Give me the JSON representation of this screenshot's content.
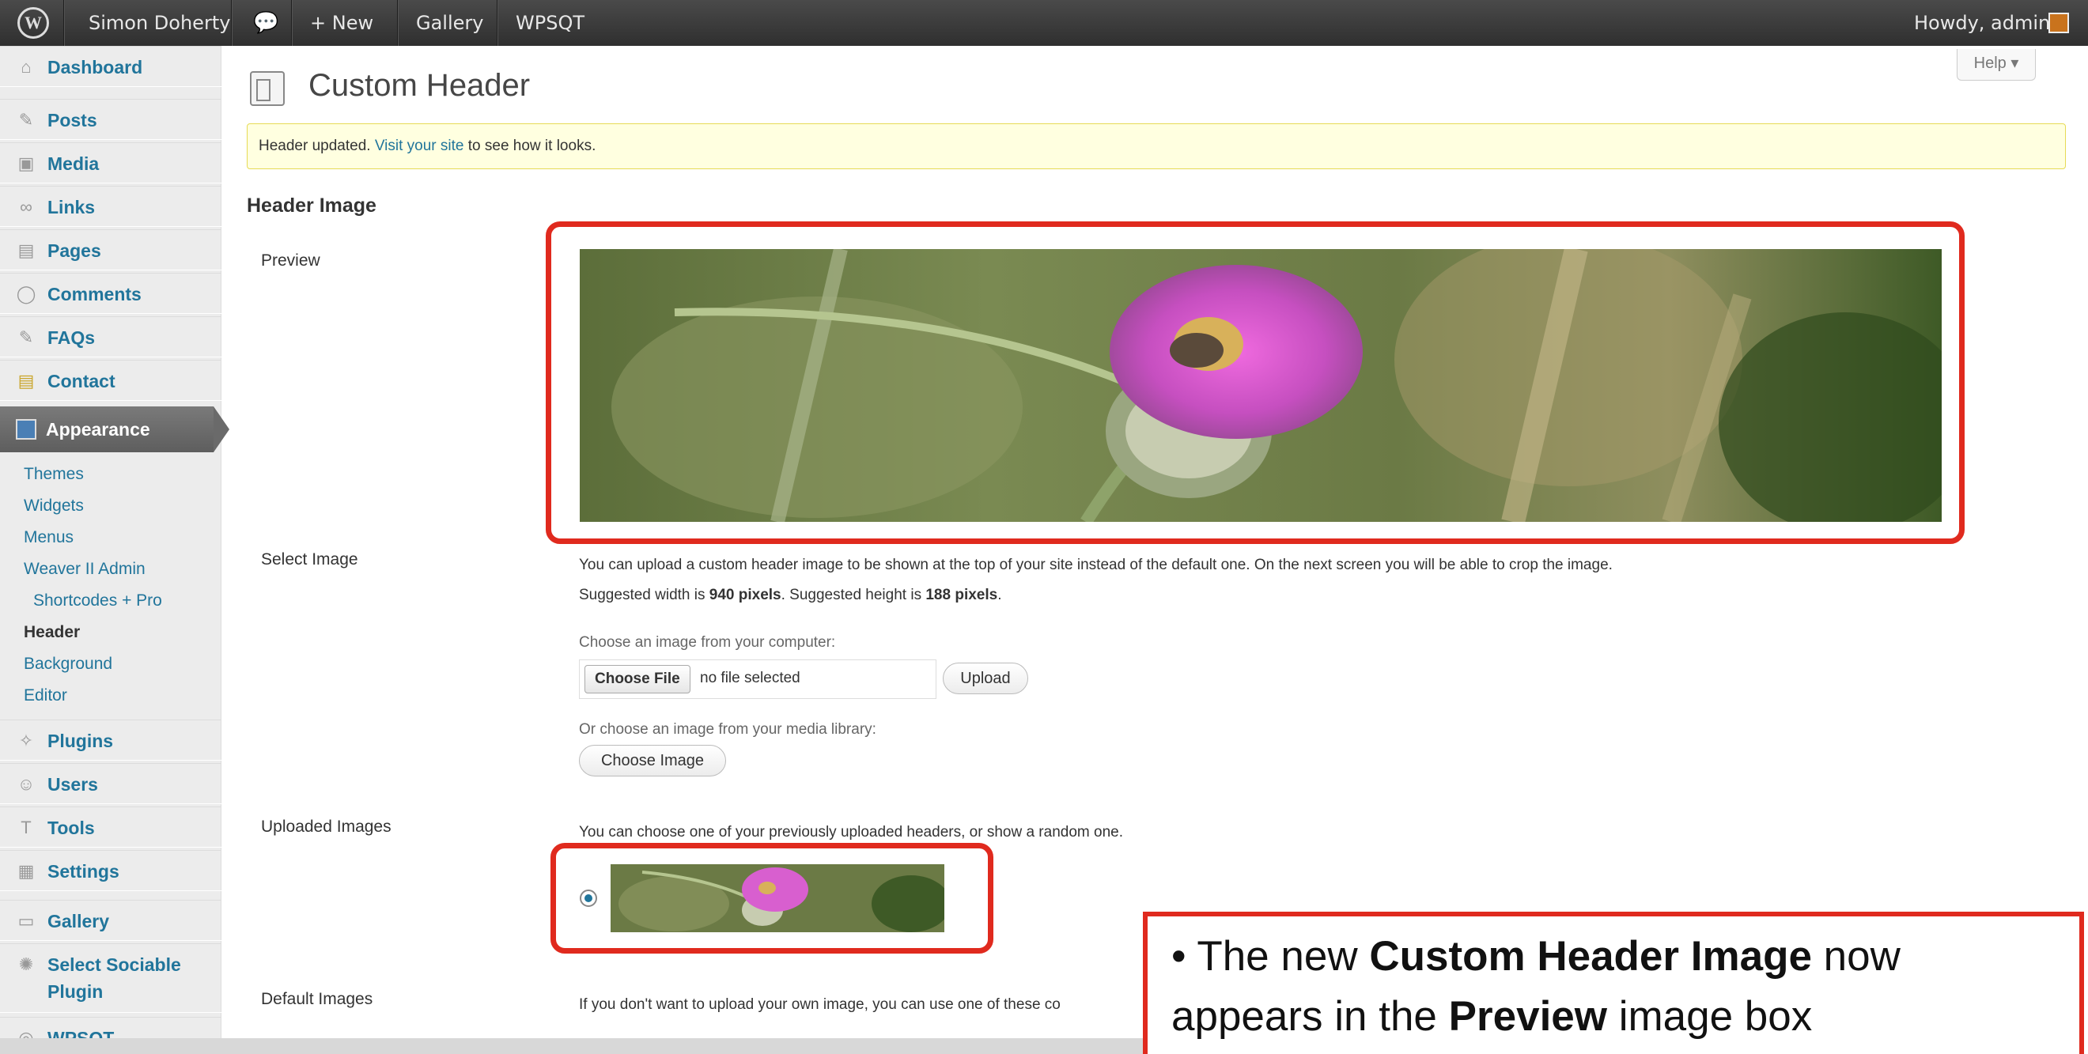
{
  "admin_bar": {
    "site_name": "Simon Doherty",
    "new_label": "+ New",
    "gallery_label": "Gallery",
    "wpsqt_label": "WPSQT",
    "greeting": "Howdy, admin"
  },
  "sidebar": {
    "items": [
      {
        "label": "Dashboard",
        "icon": "house-icon"
      },
      {
        "label": "Posts",
        "icon": "pin-icon"
      },
      {
        "label": "Media",
        "icon": "media-icon"
      },
      {
        "label": "Links",
        "icon": "link-icon"
      },
      {
        "label": "Pages",
        "icon": "page-icon"
      },
      {
        "label": "Comments",
        "icon": "comment-icon"
      },
      {
        "label": "FAQs",
        "icon": "pin-icon"
      },
      {
        "label": "Contact",
        "icon": "contact-icon"
      }
    ],
    "appearance": "Appearance",
    "submenu": [
      "Themes",
      "Widgets",
      "Menus",
      "Weaver II Admin",
      "Shortcodes + Pro",
      "Header",
      "Background",
      "Editor"
    ],
    "items2": [
      {
        "label": "Plugins",
        "icon": "plug-icon"
      },
      {
        "label": "Users",
        "icon": "users-icon"
      },
      {
        "label": "Tools",
        "icon": "tools-icon"
      },
      {
        "label": "Settings",
        "icon": "settings-icon"
      },
      {
        "label": "Gallery",
        "icon": "gallery-icon"
      },
      {
        "label": "Select Sociable",
        "label2": "Plugin",
        "icon": "sociable-icon"
      },
      {
        "label": "WPSQT",
        "icon": "wpsqt-icon"
      }
    ]
  },
  "page": {
    "title": "Custom Header",
    "help": "Help ▾",
    "notice_before": "Header updated. ",
    "notice_link": "Visit your site",
    "notice_after": " to see how it looks.",
    "section_title": "Header Image",
    "preview_label": "Preview",
    "select_label": "Select Image",
    "select_text1": "You can upload a custom header image to be shown at the top of your site instead of the default one. On the next screen you will be able to crop the image.",
    "select_text2_a": "Suggested width is ",
    "select_text2_b": "940 pixels",
    "select_text2_c": ". Suggested height is ",
    "select_text2_d": "188 pixels",
    "select_text2_e": ".",
    "choose_computer": "Choose an image from your computer:",
    "choose_file": "Choose File",
    "no_file": "no file selected",
    "upload": "Upload",
    "choose_library": "Or choose an image from your media library:",
    "choose_image": "Choose Image",
    "uploaded_label": "Uploaded Images",
    "uploaded_text": "You can choose one of your previously uploaded headers, or show a random one.",
    "default_label": "Default Images",
    "default_text": "If you don't want to upload your own image, you can use one of these co"
  },
  "callout": {
    "line1_a": "• The new ",
    "line1_b": "Custom Header Image",
    "line1_c": " now",
    "line2_a": "appears in the ",
    "line2_b": "Preview",
    "line2_c": " image box"
  },
  "colors": {
    "accent": "#21759b",
    "highlight": "#e02a1e"
  }
}
